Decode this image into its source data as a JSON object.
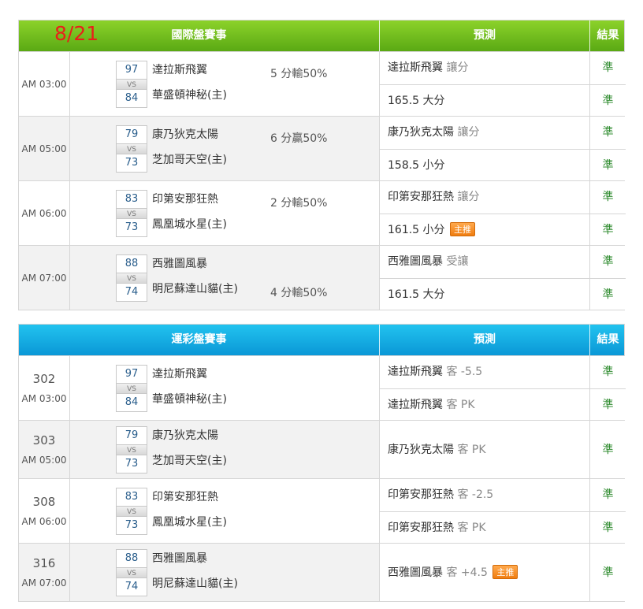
{
  "date": "8/21",
  "intl": {
    "title": "國際盤賽事",
    "pred_header": "預測",
    "result_header": "結果",
    "games": [
      {
        "time": "AM 03:00",
        "away_score": "97",
        "home_score": "84",
        "away": "達拉斯飛翼",
        "home": "華盛頓神秘(主)",
        "handicap": "5 分輸50%",
        "hc_row": 1,
        "pred1": "達拉斯飛翼",
        "pred1_sub": "讓分",
        "pred2": "165.5 大分",
        "result1": "準",
        "result2": "準"
      },
      {
        "time": "AM 05:00",
        "away_score": "79",
        "home_score": "73",
        "away": "康乃狄克太陽",
        "home": "芝加哥天空(主)",
        "handicap": "6 分贏50%",
        "hc_row": 1,
        "pred1": "康乃狄克太陽",
        "pred1_sub": "讓分",
        "pred2": "158.5 小分",
        "result1": "準",
        "result2": "準"
      },
      {
        "time": "AM 06:00",
        "away_score": "83",
        "home_score": "73",
        "away": "印第安那狂熱",
        "home": "鳳凰城水星(主)",
        "handicap": "2 分輸50%",
        "hc_row": 1,
        "pred1": "印第安那狂熱",
        "pred1_sub": "讓分",
        "pred2": "161.5 小分",
        "pred2_badge": "主推",
        "result1": "準",
        "result2": "準"
      },
      {
        "time": "AM 07:00",
        "away_score": "88",
        "home_score": "74",
        "away": "西雅圖風暴",
        "home": "明尼蘇達山貓(主)",
        "handicap": "4 分輸50%",
        "hc_row": 2,
        "pred1": "西雅圖風暴",
        "pred1_sub": "受讓",
        "pred2": "161.5 大分",
        "result1": "準",
        "result2": "準"
      }
    ]
  },
  "lott": {
    "title": "運彩盤賽事",
    "pred_header": "預測",
    "result_header": "結果",
    "games": [
      {
        "id": "302",
        "time": "AM 03:00",
        "away_score": "97",
        "home_score": "84",
        "away": "達拉斯飛翼",
        "home": "華盛頓神秘(主)",
        "pred1": "達拉斯飛翼",
        "pred1_sub": "客 -5.5",
        "pred2": "達拉斯飛翼",
        "pred2_sub": "客 PK",
        "result1": "準",
        "result2": "準"
      },
      {
        "id": "303",
        "time": "AM 05:00",
        "away_score": "79",
        "home_score": "73",
        "away": "康乃狄克太陽",
        "home": "芝加哥天空(主)",
        "pred1": "康乃狄克太陽",
        "pred1_sub": "客 PK",
        "result1": "準"
      },
      {
        "id": "308",
        "time": "AM 06:00",
        "away_score": "83",
        "home_score": "73",
        "away": "印第安那狂熱",
        "home": "鳳凰城水星(主)",
        "pred1": "印第安那狂熱",
        "pred1_sub": "客 -2.5",
        "pred2": "印第安那狂熱",
        "pred2_sub": "客 PK",
        "result1": "準",
        "result2": "準"
      },
      {
        "id": "316",
        "time": "AM 07:00",
        "away_score": "88",
        "home_score": "74",
        "away": "西雅圖風暴",
        "home": "明尼蘇達山貓(主)",
        "pred1": "西雅圖風暴",
        "pred1_sub": "客 +4.5",
        "pred1_badge": "主推",
        "result1": "準"
      }
    ],
    "vs_label": "VS"
  }
}
